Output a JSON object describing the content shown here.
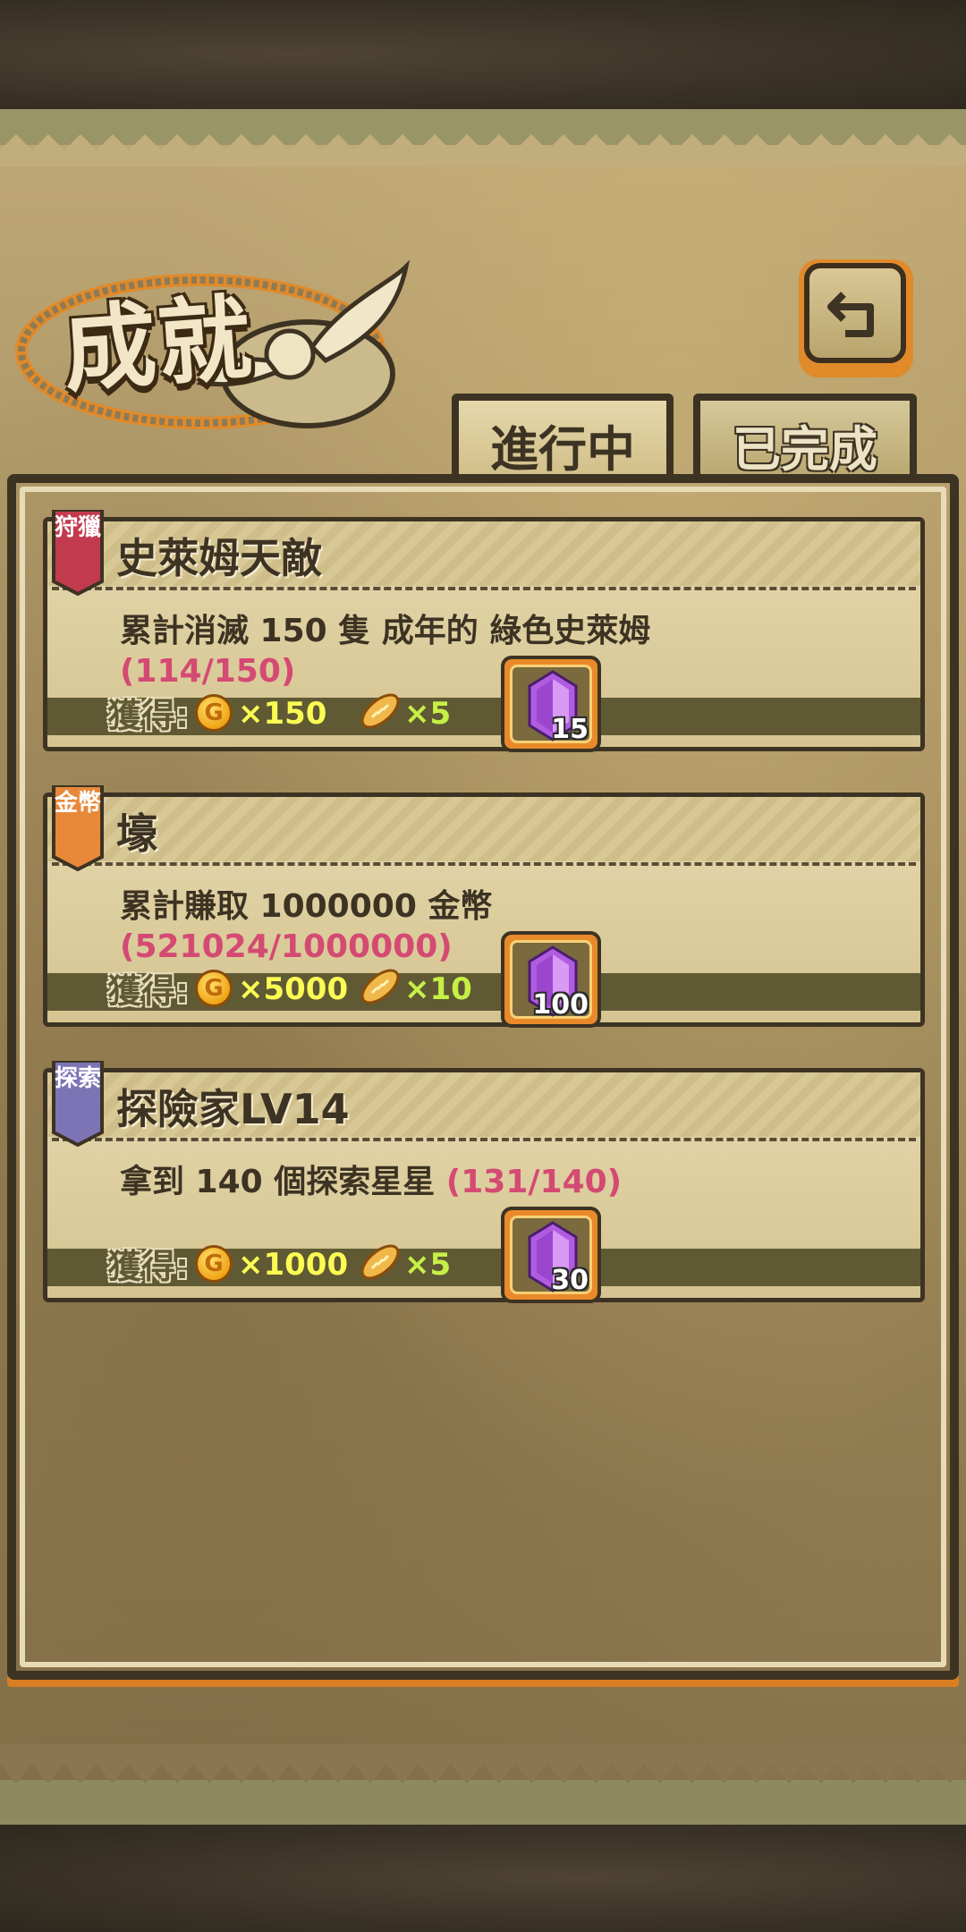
{
  "title": "成就",
  "tabs": [
    {
      "label": "進行中",
      "active": true
    },
    {
      "label": "已完成",
      "active": false
    }
  ],
  "reward_label": "獲得:",
  "achievements": [
    {
      "badge": "狩獵",
      "badge_color": "#c23a4e",
      "name": "史萊姆天敵",
      "description": "累計消滅 150 隻 成年的 綠色史萊姆",
      "progress": "(114/150)",
      "progress_inline": false,
      "coin_amount": "×150",
      "bread_amount": "×5",
      "gem_amount": "15"
    },
    {
      "badge": "金幣",
      "badge_color": "#e8893a",
      "name": "壕",
      "description": "累計賺取 1000000 金幣",
      "progress": "(521024/1000000)",
      "progress_inline": false,
      "coin_amount": "×5000",
      "bread_amount": "×10",
      "gem_amount": "100"
    },
    {
      "badge": "探索",
      "badge_color": "#7d74b5",
      "name": "探險家LV14",
      "description": "拿到 140 個探索星星",
      "progress": "(131/140)",
      "progress_inline": true,
      "coin_amount": "×1000",
      "bread_amount": "×5",
      "gem_amount": "30"
    }
  ]
}
